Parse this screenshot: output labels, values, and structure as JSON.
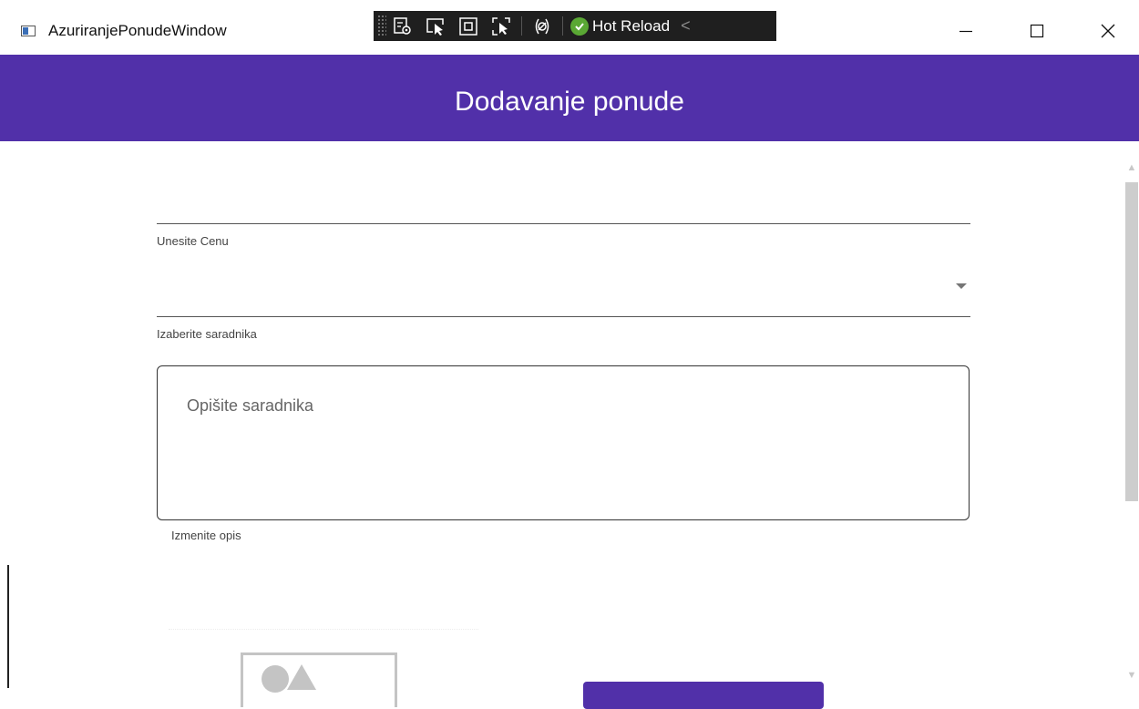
{
  "window": {
    "title": "AzuriranjePonudeWindow",
    "icon": "app-window-icon",
    "controls": {
      "minimize": "minimize-icon",
      "maximize": "maximize-icon",
      "close": "close-icon"
    }
  },
  "debug_toolbar": {
    "buttons": [
      "live-visual-tree-icon",
      "select-element-icon",
      "display-layout-adorners-icon",
      "track-focus-icon",
      "binding-failures-icon"
    ],
    "hot_reload_label": "Hot Reload",
    "hot_reload_status_icon": "check-circle-icon",
    "collapse_icon": "chevron-left-icon"
  },
  "header": {
    "title": "Dodavanje ponude"
  },
  "form": {
    "price": {
      "value": "",
      "helper": "Unesite Cenu"
    },
    "partner": {
      "selected": "",
      "helper": "Izaberite saradnika"
    },
    "description": {
      "placeholder": "Opišite saradnika",
      "helper": "Izmenite opis"
    }
  },
  "colors": {
    "accent": "#5130a9",
    "hot_reload_ok": "#5aa834",
    "toolbar_bg": "#1f1f1f"
  }
}
